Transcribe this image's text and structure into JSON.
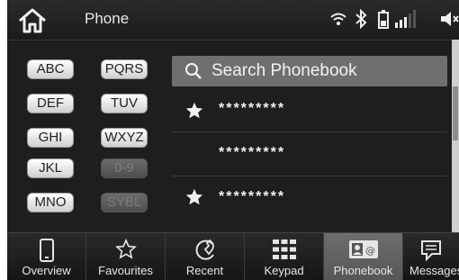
{
  "header": {
    "title": "Phone"
  },
  "letter_buttons": [
    {
      "label": "ABC",
      "enabled": true
    },
    {
      "label": "PQRS",
      "enabled": true
    },
    {
      "label": "DEF",
      "enabled": true
    },
    {
      "label": "TUV",
      "enabled": true
    },
    {
      "label": "GHI",
      "enabled": true
    },
    {
      "label": "WXYZ",
      "enabled": true
    },
    {
      "label": "JKL",
      "enabled": true
    },
    {
      "label": "0-9",
      "enabled": false
    },
    {
      "label": "MNO",
      "enabled": true
    },
    {
      "label": "SYBL",
      "enabled": false
    }
  ],
  "search": {
    "label": "Search Phonebook"
  },
  "contacts": [
    {
      "name": "*********",
      "favorite": true
    },
    {
      "name": "*********",
      "favorite": false
    },
    {
      "name": "*********",
      "favorite": true
    }
  ],
  "tabs": [
    {
      "label": "Overview",
      "icon": "phone-icon"
    },
    {
      "label": "Favourites",
      "icon": "star-icon"
    },
    {
      "label": "Recent",
      "icon": "recent-calls-icon"
    },
    {
      "label": "Keypad",
      "icon": "keypad-icon"
    },
    {
      "label": "Phonebook",
      "icon": "phonebook-icon",
      "active": true
    },
    {
      "label": "Messages",
      "icon": "message-icon"
    }
  ],
  "colors": {
    "background": "#1e1e1e",
    "active_tab": "#5e5e5e",
    "search_bar": "#6f6f6f"
  }
}
